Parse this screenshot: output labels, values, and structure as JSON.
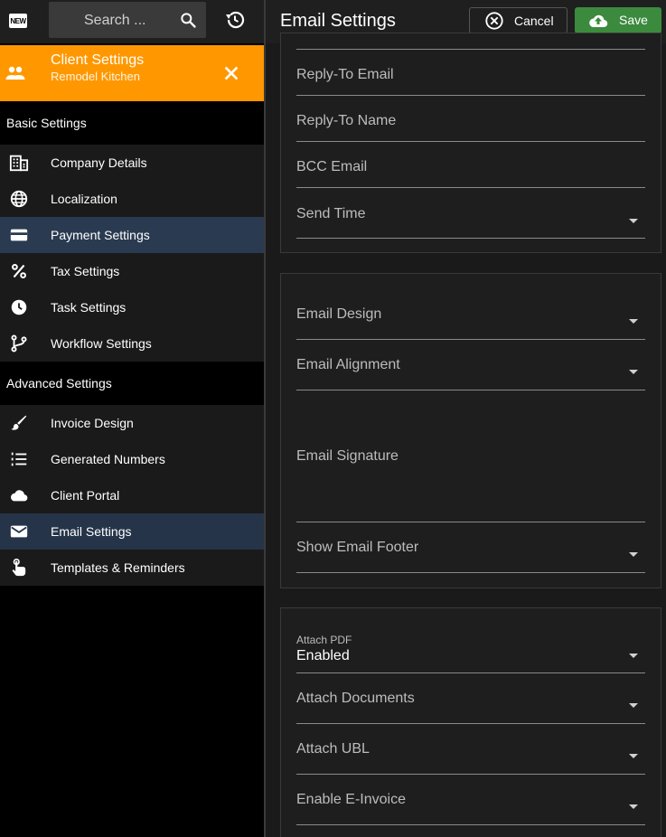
{
  "sidebar": {
    "new_badge": "NEW",
    "search_placeholder": "Search ...",
    "client": {
      "title": "Client Settings",
      "subtitle": "Remodel Kitchen"
    },
    "basic_header": "Basic Settings",
    "basic_items": [
      {
        "label": "Company Details",
        "icon": "building-icon"
      },
      {
        "label": "Localization",
        "icon": "globe-icon"
      },
      {
        "label": "Payment Settings",
        "icon": "credit-card-icon"
      },
      {
        "label": "Tax Settings",
        "icon": "percent-icon"
      },
      {
        "label": "Task Settings",
        "icon": "clock-icon"
      },
      {
        "label": "Workflow Settings",
        "icon": "branch-icon"
      }
    ],
    "advanced_header": "Advanced Settings",
    "advanced_items": [
      {
        "label": "Invoice Design",
        "icon": "brush-icon"
      },
      {
        "label": "Generated Numbers",
        "icon": "numbered-list-icon"
      },
      {
        "label": "Client Portal",
        "icon": "cloud-icon"
      },
      {
        "label": "Email Settings",
        "icon": "mail-icon"
      },
      {
        "label": "Templates & Reminders",
        "icon": "hand-pointer-icon"
      }
    ]
  },
  "header": {
    "title": "Email Settings",
    "cancel_label": "Cancel",
    "save_label": "Save"
  },
  "panel1": {
    "fields": [
      "Reply-To Email",
      "Reply-To Name",
      "BCC Email",
      "Send Time"
    ]
  },
  "panel2": {
    "fields": [
      "Email Design",
      "Email Alignment",
      "Email Signature",
      "Show Email Footer"
    ]
  },
  "panel3": {
    "attach_pdf_label": "Attach PDF",
    "attach_pdf_value": "Enabled",
    "fields": [
      "Attach Documents",
      "Attach UBL",
      "Enable E-Invoice"
    ]
  },
  "colors": {
    "accent_orange": "#ff9800",
    "save_green": "#3b8a3e",
    "active_item": "#2a3a50"
  }
}
